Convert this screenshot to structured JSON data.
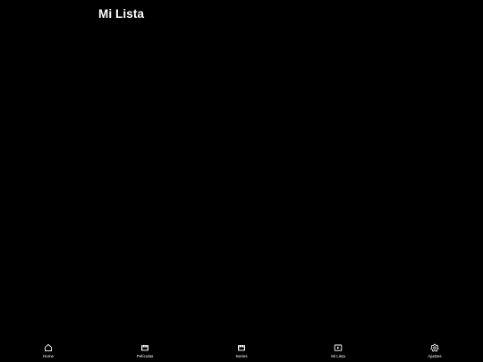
{
  "header": {
    "title": "Mi Lista"
  },
  "tabbar": {
    "items": [
      {
        "label": "Home",
        "icon": "home-icon"
      },
      {
        "label": "Películas",
        "icon": "film-icon"
      },
      {
        "label": "Series",
        "icon": "tv-series-icon"
      },
      {
        "label": "Mi Lista",
        "icon": "play-list-icon"
      },
      {
        "label": "Ajustes",
        "icon": "gear-icon"
      }
    ]
  },
  "colors": {
    "background": "#000000",
    "text": "#ffffff"
  }
}
